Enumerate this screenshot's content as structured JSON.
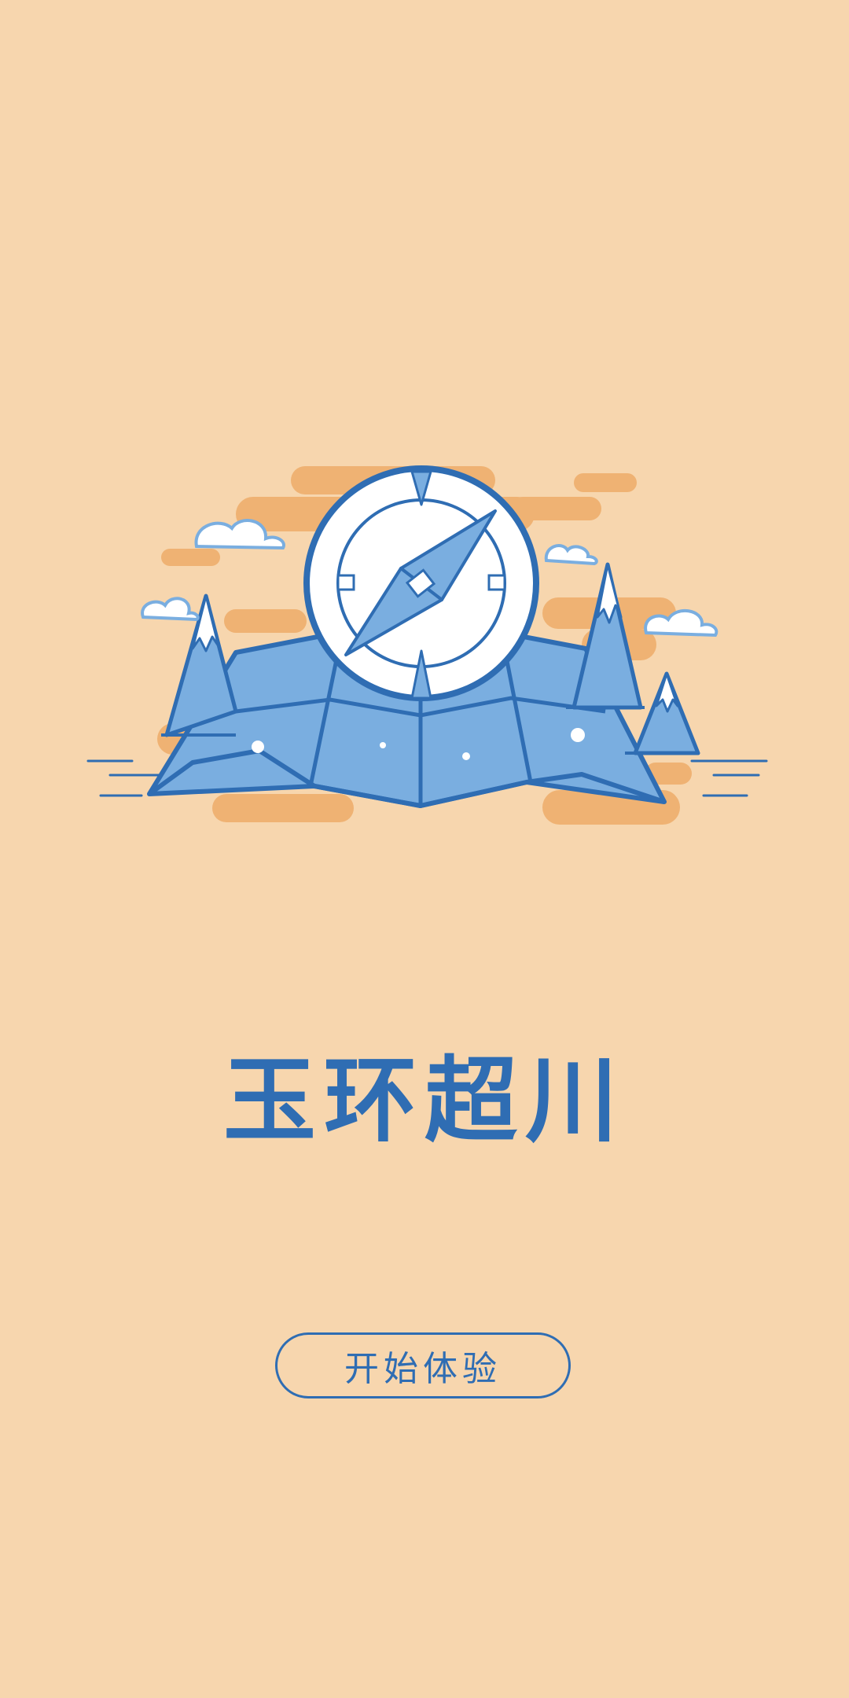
{
  "app": {
    "title": "玉环超川",
    "start_button_label": "开始体验"
  },
  "illustration": {
    "subject": "compass-over-folded-map-with-mountains-and-clouds"
  },
  "colors": {
    "background": "#f7d6ae",
    "accent": "#2f6db3",
    "illustration_fill": "#7aaee0",
    "decor_orange": "#efb273"
  }
}
